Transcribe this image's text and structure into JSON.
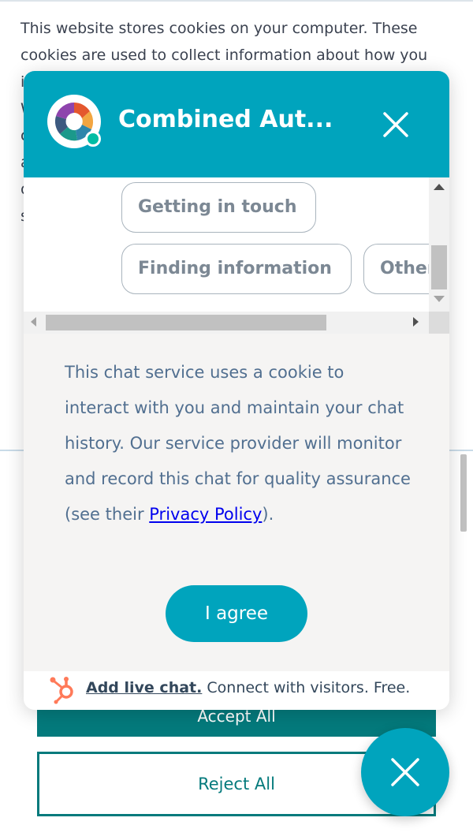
{
  "cookie_banner": {
    "text": "This website stores cookies on your computer. These cookies are used to collect information about how you interact with our website and allow us to remember you. We use this information in order to improve and customize your browsing experience and for analytics and metrics about our visitors both on this website and other media. To find out more about the cookies we use, see our Privacy Policy.",
    "accept_label": "Accept All",
    "reject_label": "Reject All"
  },
  "chat": {
    "title": "Combined Aut...",
    "quick_replies": [
      "Getting in touch",
      "Finding information",
      "Other"
    ],
    "consent": {
      "text_before_link": "This chat service uses a cookie to interact with you and maintain your chat history. Our service provider will monitor and record this chat for quality assurance (see their ",
      "link_label": "Privacy Policy",
      "text_after_link": ").",
      "agree_label": "I agree"
    },
    "footer": {
      "link_label": "Add live chat.",
      "text": " Connect with visitors. Free."
    }
  },
  "colors": {
    "chat_accent": "#00a4bd",
    "cookie_accent": "#047a7c",
    "online_dot": "#00bda5",
    "hubspot_orange": "#ff7a59"
  },
  "icons": {
    "close": "close-icon",
    "launcher_close": "close-icon",
    "brand": "hubspot-sprocket-icon",
    "avatar": "company-logo-icon"
  }
}
